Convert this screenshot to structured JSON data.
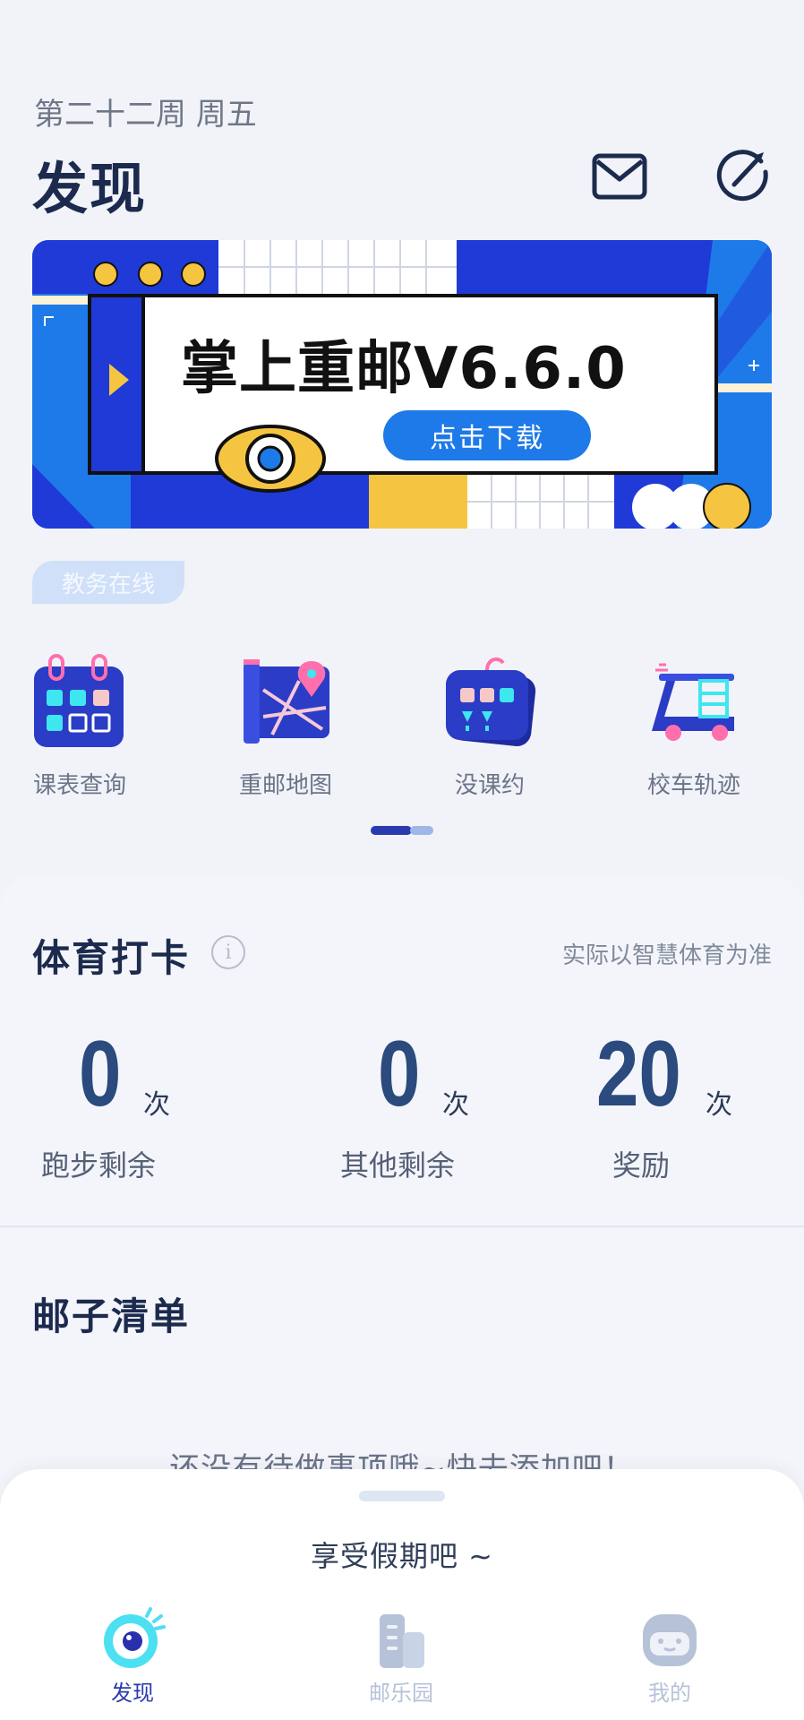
{
  "header": {
    "week_label": "第二十二周 周五",
    "title": "发现",
    "mail_icon": "mail-icon",
    "compass_icon": "compass-icon"
  },
  "banner": {
    "title": "掌上重邮V6.6.0",
    "button_label": "点击下载",
    "colors": {
      "blue": "#1f3ad6",
      "light_blue": "#1e7ae8",
      "yellow": "#f5c542"
    }
  },
  "section_pill": "教务在线",
  "shortcuts": [
    {
      "label": "课表查询",
      "icon": "calendar-icon"
    },
    {
      "label": "重邮地图",
      "icon": "map-icon"
    },
    {
      "label": "没课约",
      "icon": "schedule-match-icon"
    },
    {
      "label": "校车轨迹",
      "icon": "bus-icon"
    }
  ],
  "sports": {
    "title": "体育打卡",
    "note": "实际以智慧体育为准",
    "stats": [
      {
        "value": "0",
        "unit": "次",
        "label": "跑步剩余"
      },
      {
        "value": "0",
        "unit": "次",
        "label": "其他剩余"
      },
      {
        "value": "20",
        "unit": "次",
        "label": "奖励"
      }
    ]
  },
  "todo": {
    "title": "邮子清单",
    "empty_text": "还没有待做事项哦~快去添加吧！"
  },
  "sheet": {
    "message": "享受假期吧 ~"
  },
  "nav": {
    "items": [
      {
        "label": "发现",
        "active": true
      },
      {
        "label": "邮乐园",
        "active": false
      },
      {
        "label": "我的",
        "active": false
      }
    ],
    "colors": {
      "active": "#2a3bb0",
      "inactive": "#b6c2d8"
    }
  }
}
